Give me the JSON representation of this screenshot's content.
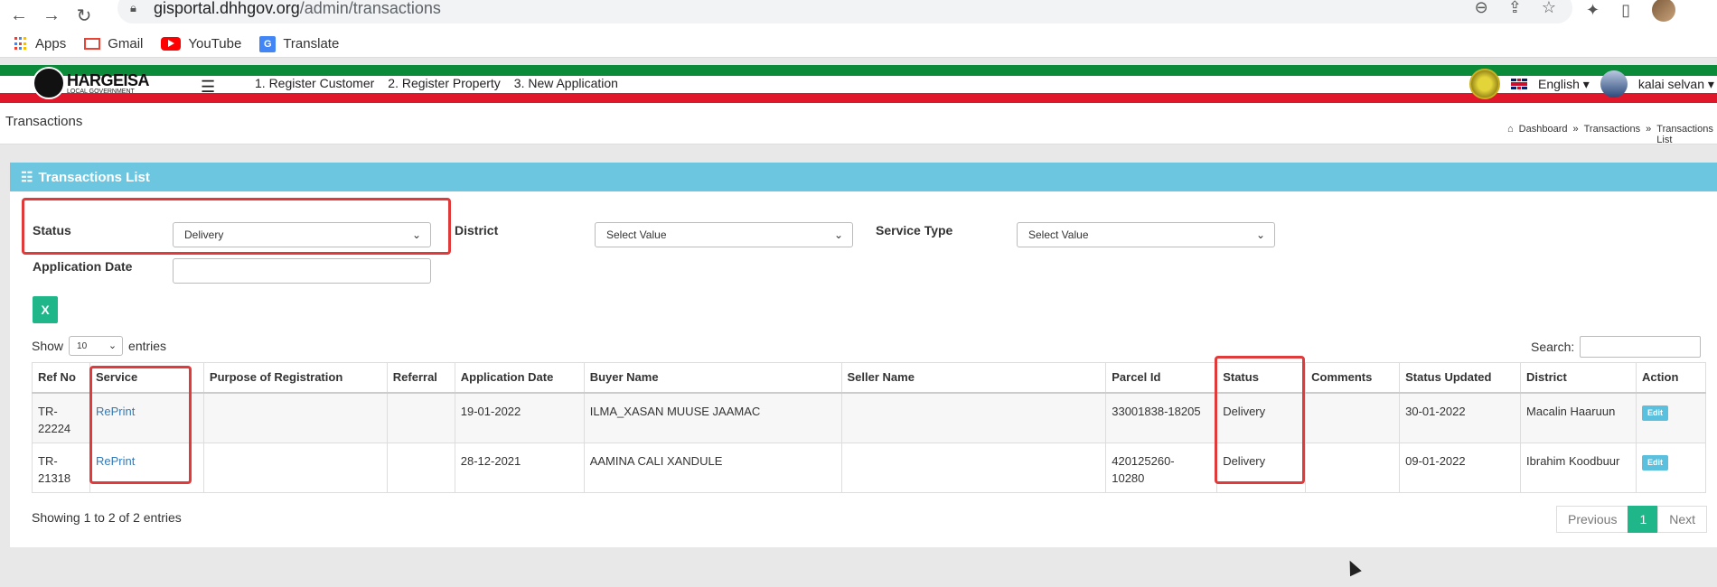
{
  "browser": {
    "url_host": "gisportal.dhhgov.org",
    "url_path": "/admin/transactions",
    "bookmarks": [
      "Apps",
      "Gmail",
      "YouTube",
      "Translate"
    ]
  },
  "header": {
    "logo_title": "HARGEISA",
    "logo_sub": "LOCAL GOVERNMENT",
    "menu": [
      "1. Register Customer",
      "2. Register Property",
      "3. New Application"
    ],
    "language": "English",
    "user": "kalai selvan"
  },
  "page": {
    "title": "Transactions",
    "breadcrumb": [
      "Dashboard",
      "Transactions",
      "Transactions List"
    ]
  },
  "panel": {
    "title": "Transactions List",
    "filters": {
      "status_label": "Status",
      "status_value": "Delivery",
      "district_label": "District",
      "district_value": "Select Value",
      "service_type_label": "Service Type",
      "service_type_value": "Select Value",
      "app_date_label": "Application Date",
      "app_date_value": ""
    },
    "show_label": "Show",
    "entries_label": "entries",
    "page_length": "10",
    "search_label": "Search:",
    "columns": [
      "Ref No",
      "Service",
      "Purpose of Registration",
      "Referral",
      "Application Date",
      "Buyer Name",
      "Seller Name",
      "Parcel Id",
      "Status",
      "Comments",
      "Status Updated",
      "District",
      "Action"
    ],
    "rows": [
      {
        "ref": "TR-\n22224",
        "service": "RePrint",
        "purpose": "",
        "referral": "",
        "app_date": "19-01-2022",
        "buyer": "ILMA_XASAN MUUSE JAAMAC",
        "seller": "",
        "parcel": "33001838-18205",
        "status": "Delivery",
        "comments": "",
        "updated": "30-01-2022",
        "district": "Macalin Haaruun",
        "action": "Edit"
      },
      {
        "ref": "TR-\n21318",
        "service": "RePrint",
        "purpose": "",
        "referral": "",
        "app_date": "28-12-2021",
        "buyer": "AAMINA CALI XANDULE",
        "seller": "",
        "parcel": "420125260-\n10280",
        "status": "Delivery",
        "comments": "",
        "updated": "09-01-2022",
        "district": "Ibrahim Koodbuur",
        "action": "Edit"
      }
    ],
    "info": "Showing 1 to 2 of 2 entries",
    "pager": {
      "prev": "Previous",
      "current": "1",
      "next": "Next"
    }
  }
}
